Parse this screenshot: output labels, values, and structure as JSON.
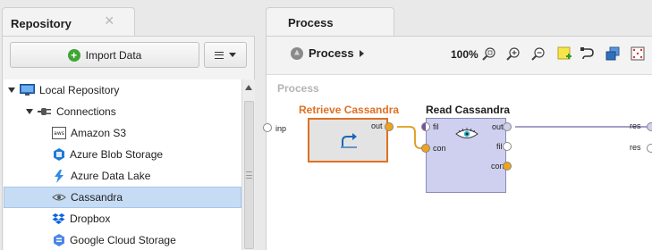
{
  "repository": {
    "tab_title": "Repository",
    "close_symbol": "×",
    "import_label": "Import Data",
    "import_icon": "plus",
    "menu_icon": "hamburger",
    "tree": [
      {
        "label": "Local Repository",
        "icon": "monitor-icon",
        "level": 0,
        "expanded": true
      },
      {
        "label": "Connections",
        "icon": "plug-icon",
        "level": 1,
        "expanded": true
      },
      {
        "label": "Amazon S3",
        "icon": "aws-icon",
        "level": 2,
        "icon_text": "aws"
      },
      {
        "label": "Azure Blob Storage",
        "icon": "azure-blob-icon",
        "level": 2
      },
      {
        "label": "Azure Data Lake",
        "icon": "lightning-icon",
        "level": 2
      },
      {
        "label": "Cassandra",
        "icon": "cassandra-eye-icon",
        "level": 2,
        "selected": true
      },
      {
        "label": "Dropbox",
        "icon": "dropbox-icon",
        "level": 2
      },
      {
        "label": "Google Cloud Storage",
        "icon": "google-cloud-icon",
        "level": 2
      }
    ]
  },
  "process": {
    "tab_title": "Process",
    "breadcrumb": "Process",
    "zoom": "100%",
    "canvas_title": "Process",
    "input_port": "inp",
    "result_ports": [
      "res",
      "res"
    ],
    "operators": [
      {
        "title": "Retrieve Cassandra",
        "ports_out": [
          "out"
        ],
        "accent": "#e07022"
      },
      {
        "title": "Read Cassandra",
        "ports_in": [
          "fil",
          "con"
        ],
        "ports_out": [
          "out",
          "fil",
          "con"
        ]
      }
    ],
    "toolbar_icons": [
      "zoom-fit-icon",
      "zoom-in-icon",
      "zoom-out-icon",
      "add-note-icon",
      "auto-wire-icon",
      "layers-icon",
      "arrange-icon"
    ]
  }
}
